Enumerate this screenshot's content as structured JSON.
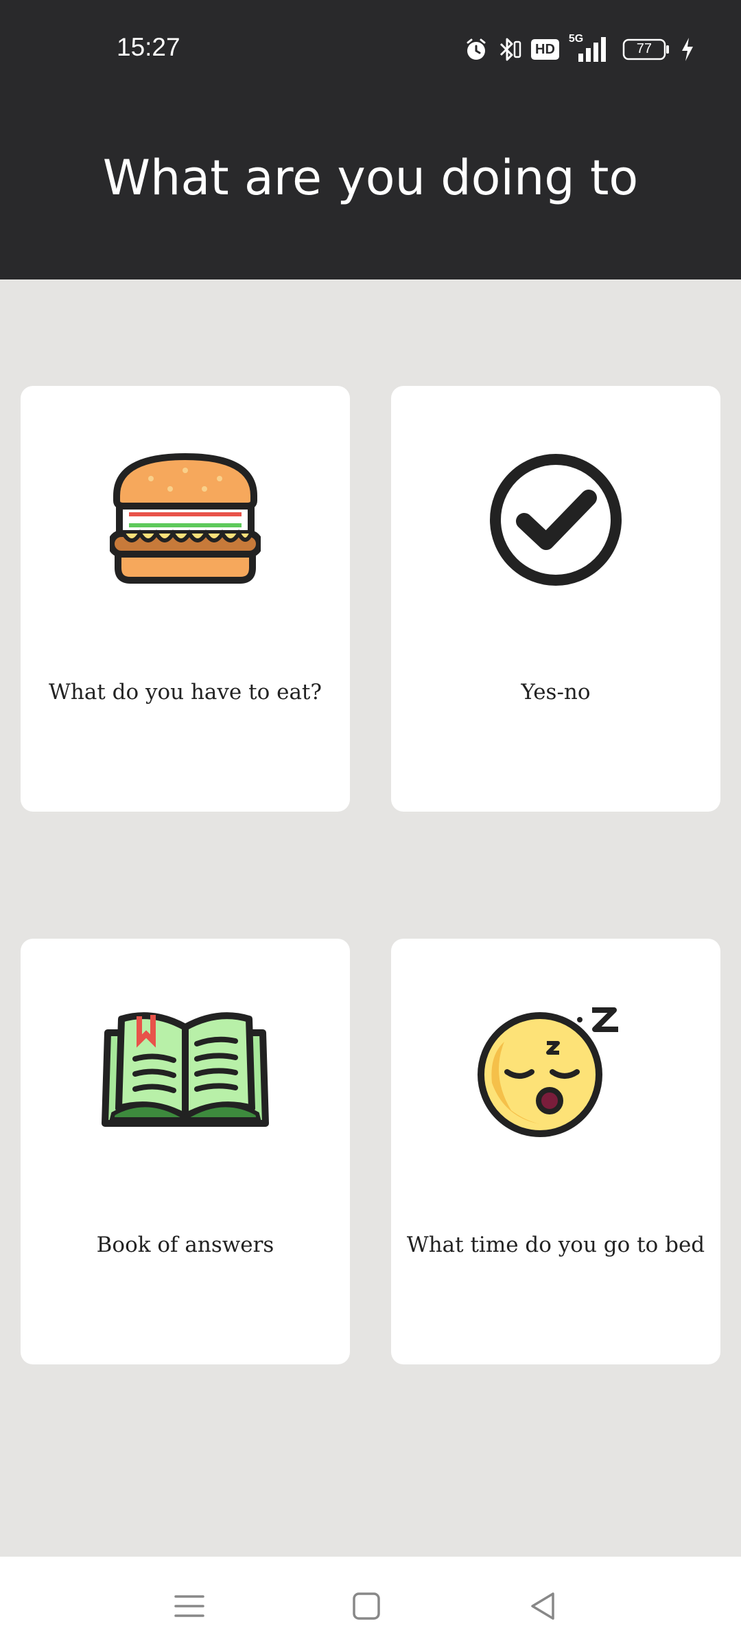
{
  "status_bar": {
    "time": "15:27",
    "network": "5G",
    "hd": "HD",
    "battery": "77",
    "icons": [
      "alarm-icon",
      "bluetooth-icon",
      "hd-icon",
      "signal-5g-icon",
      "battery-icon",
      "charging-icon"
    ]
  },
  "header": {
    "title": "What are you doing to"
  },
  "cards": [
    {
      "label": "What do you have to eat?",
      "icon": "hamburger-icon"
    },
    {
      "label": "Yes-no",
      "icon": "checkmark-circle-icon"
    },
    {
      "label": "Book of answers",
      "icon": "open-book-icon"
    },
    {
      "label": "What time do you go to bed",
      "icon": "sleeping-face-icon"
    }
  ],
  "nav": {
    "icons": [
      "menu-icon",
      "home-icon",
      "back-icon"
    ]
  },
  "colors": {
    "header_bg": "#29292b",
    "page_bg": "#e5e4e2",
    "card_bg": "#ffffff"
  }
}
